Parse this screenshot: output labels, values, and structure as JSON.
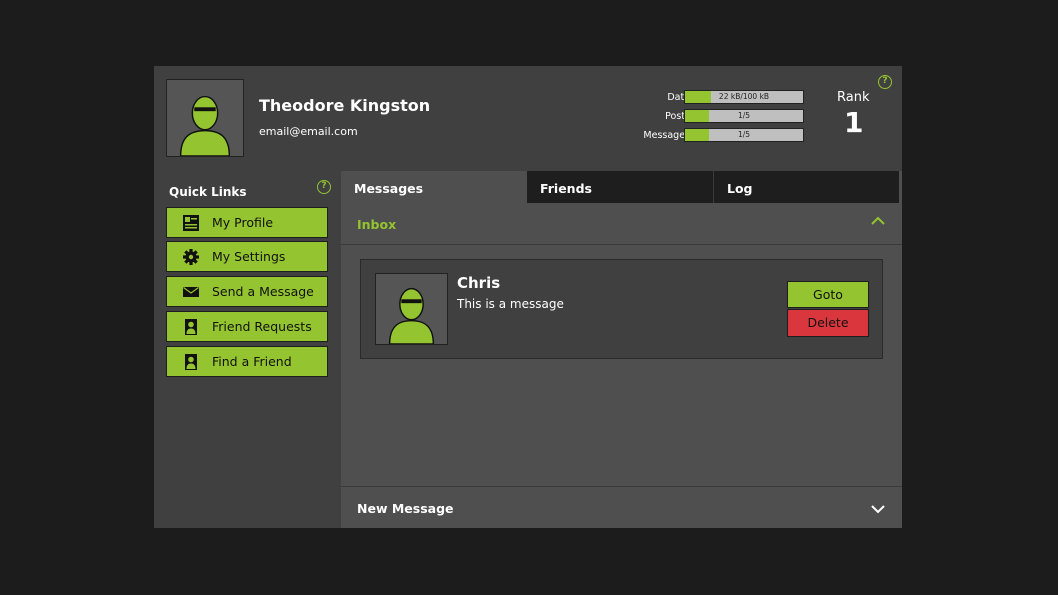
{
  "user": {
    "name": "Theodore Kingston",
    "email": "email@email.com"
  },
  "stats": [
    {
      "label": "Data",
      "text": "22 kB/100 kB",
      "fill": 0.22
    },
    {
      "label": "Posts",
      "text": "1/5",
      "fill": 0.2
    },
    {
      "label": "Messages",
      "text": "1/5",
      "fill": 0.2
    }
  ],
  "rank": {
    "label": "Rank",
    "value": "1"
  },
  "help": {
    "glyph": "?"
  },
  "quick_links": {
    "title": "Quick Links",
    "items": [
      {
        "label": "My Profile",
        "icon": "profile-card-icon"
      },
      {
        "label": "My Settings",
        "icon": "gear-icon"
      },
      {
        "label": "Send a Message",
        "icon": "envelope-icon"
      },
      {
        "label": "Friend Requests",
        "icon": "person-icon"
      },
      {
        "label": "Find a Friend",
        "icon": "person-icon"
      }
    ]
  },
  "tabs": [
    {
      "label": "Messages",
      "active": true
    },
    {
      "label": "Friends",
      "active": false
    },
    {
      "label": "Log",
      "active": false
    }
  ],
  "inbox": {
    "title": "Inbox",
    "messages": [
      {
        "sender": "Chris",
        "text": "This is a message",
        "goto_label": "Goto",
        "delete_label": "Delete"
      }
    ]
  },
  "new_message": {
    "title": "New Message"
  },
  "colors": {
    "accent": "#94c530",
    "danger": "#d9363e",
    "background": "#1c1c1c",
    "panel": "#404040"
  }
}
